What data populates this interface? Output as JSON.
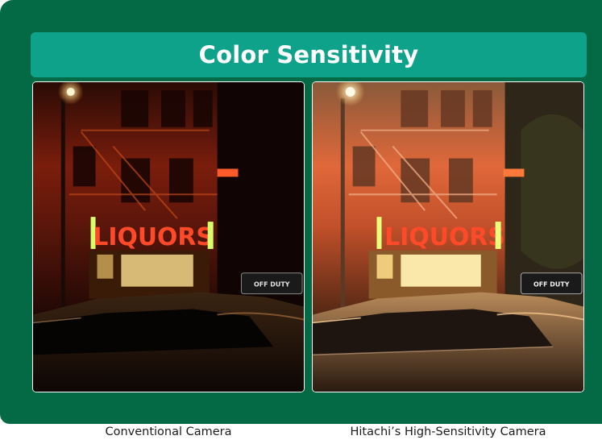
{
  "title": "Color Sensitivity",
  "photos": {
    "left": {
      "caption": "Conventional Camera",
      "sign_text": "LIQUORS",
      "taxi_text": "OFF DUTY"
    },
    "right": {
      "caption": "Hitachi’s High-Sensitivity Camera",
      "sign_text": "LIQUORS",
      "taxi_text": "OFF DUTY"
    }
  },
  "colors": {
    "panel_green": "#036a45",
    "title_teal": "#0fa28b",
    "title_text": "#ffffff",
    "sign_red": "#ff4a2a",
    "sign_yellow_green": "#e7ff7a"
  }
}
